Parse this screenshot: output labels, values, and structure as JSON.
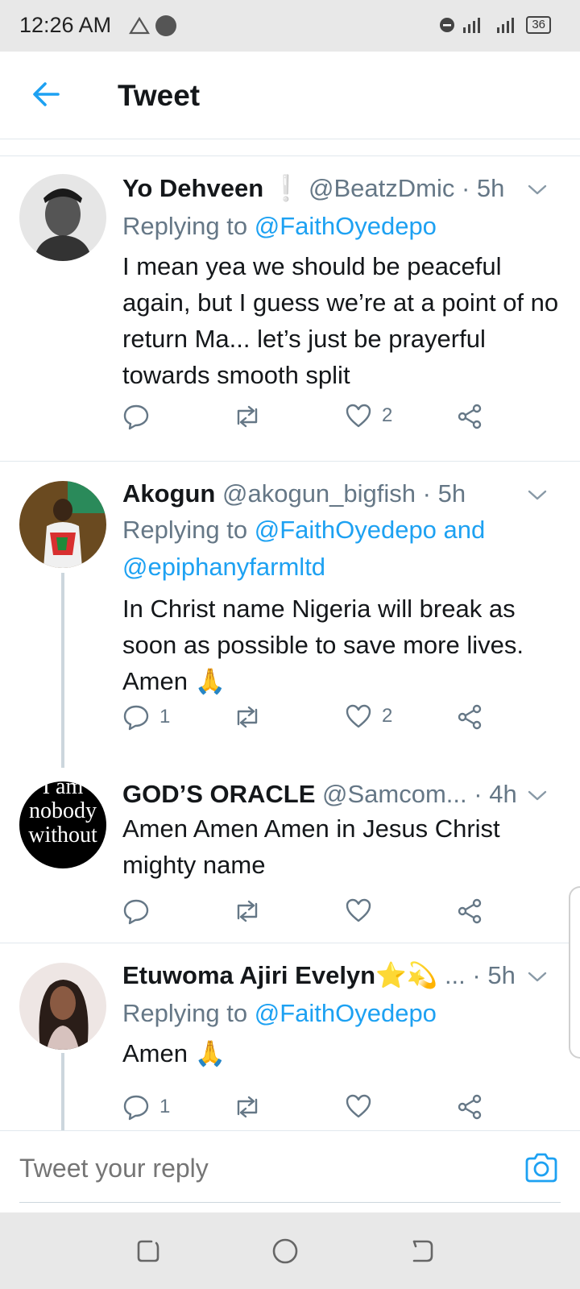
{
  "status_bar": {
    "time": "12:26 AM",
    "battery": "36"
  },
  "header": {
    "title": "Tweet"
  },
  "tweets": [
    {
      "name": "Yo Dehveen",
      "name_suffix": "❕",
      "handle": "@BeatzDmic",
      "time": "· 5h",
      "replying_prefix": "Replying to",
      "replying_to": "@FaithOyedepo",
      "text": "I mean yea we should be peaceful again, but I guess we’re at a point of no return Ma... let’s just be prayerful towards smooth split",
      "reply_count": "",
      "retweet_count": "",
      "like_count": "2"
    },
    {
      "name": "Akogun",
      "handle": "@akogun_bigfish",
      "time": "· 5h",
      "replying_prefix": "Replying to",
      "replying_to": "@FaithOyedepo and",
      "replying_to_2": "@epiphanyfarmltd",
      "text": "In Christ name Nigeria will break as soon as possible to save more lives. Amen 🙏",
      "reply_count": "1",
      "retweet_count": "",
      "like_count": "2"
    },
    {
      "name": "GOD’S ORACLE",
      "handle": "@Samcom...",
      "time": "· 4h",
      "avatar_text": "I am nobody without",
      "text": "Amen Amen Amen in Jesus Christ mighty name",
      "reply_count": "",
      "retweet_count": "",
      "like_count": ""
    },
    {
      "name": "Etuwoma Ajiri Evelyn⭐💫",
      "handle": "...",
      "time": "· 5h",
      "replying_prefix": "Replying to",
      "replying_to": "@FaithOyedepo",
      "text": "Amen 🙏",
      "reply_count": "1",
      "retweet_count": "",
      "like_count": ""
    }
  ],
  "composer": {
    "placeholder": "Tweet your reply"
  },
  "colors": {
    "accent": "#1da1f2",
    "secondary_text": "#657786",
    "divider": "#e1e8ed"
  }
}
